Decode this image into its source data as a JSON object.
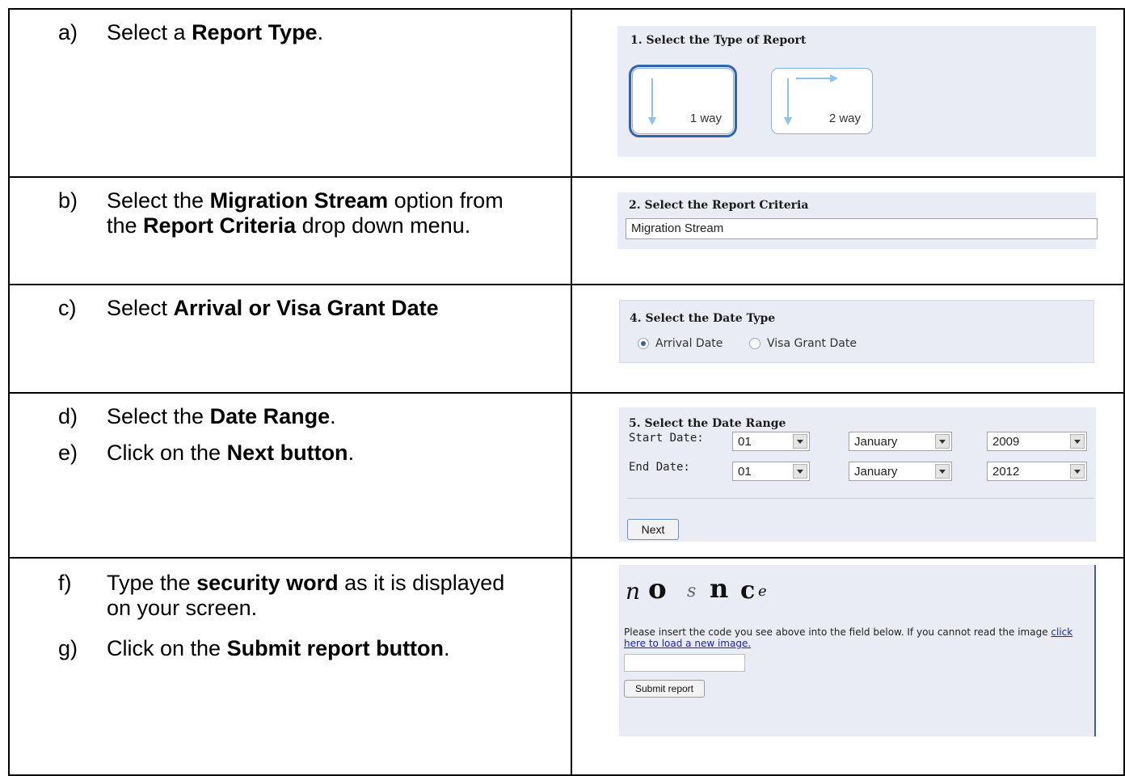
{
  "steps": [
    {
      "marker": "a)",
      "parts": [
        "Select a ",
        "Report Type",
        "."
      ]
    },
    {
      "marker": "b)",
      "parts": [
        "Select the ",
        "Migration Stream",
        " option from the ",
        "Report Criteria",
        " drop down menu."
      ]
    },
    {
      "marker": "c)",
      "parts": [
        "Select ",
        "Arrival or Visa Grant Date"
      ]
    },
    {
      "marker": "d)",
      "parts": [
        "Select the ",
        "Date Range",
        "."
      ]
    },
    {
      "marker": "e)",
      "parts": [
        "Click on the ",
        "Next button",
        "."
      ]
    },
    {
      "marker": "f)",
      "parts": [
        "Type the ",
        "security word",
        " as it is displayed on your screen."
      ]
    },
    {
      "marker": "g)",
      "parts": [
        "Click on the ",
        "Submit report button",
        "."
      ]
    }
  ],
  "report_type": {
    "title": "1. Select the Type of Report",
    "options": [
      {
        "label": "1 way",
        "selected": true
      },
      {
        "label": "2 way",
        "selected": false
      }
    ]
  },
  "criteria": {
    "title": "2. Select the Report Criteria",
    "value": "Migration Stream"
  },
  "date_type": {
    "title": "4. Select the Date Type",
    "options": [
      {
        "label": "Arrival Date",
        "selected": true
      },
      {
        "label": "Visa Grant Date",
        "selected": false
      }
    ]
  },
  "date_range": {
    "title": "5. Select the Date Range",
    "start_label": "Start Date:",
    "end_label": "End Date:",
    "start": {
      "day": "01",
      "month": "January",
      "year": "2009"
    },
    "end": {
      "day": "01",
      "month": "January",
      "year": "2012"
    },
    "next_label": "Next"
  },
  "security": {
    "captcha_text": "nosnce",
    "instruction": "Please insert the code you see above into the field below. If you cannot read the image ",
    "link_text": "click here to load a new image.",
    "input_value": "",
    "submit_label": "Submit report"
  },
  "colors": {
    "panel_bg": "#e9ecf5",
    "selected_border": "#2e64b3",
    "link": "#1a24b8"
  }
}
